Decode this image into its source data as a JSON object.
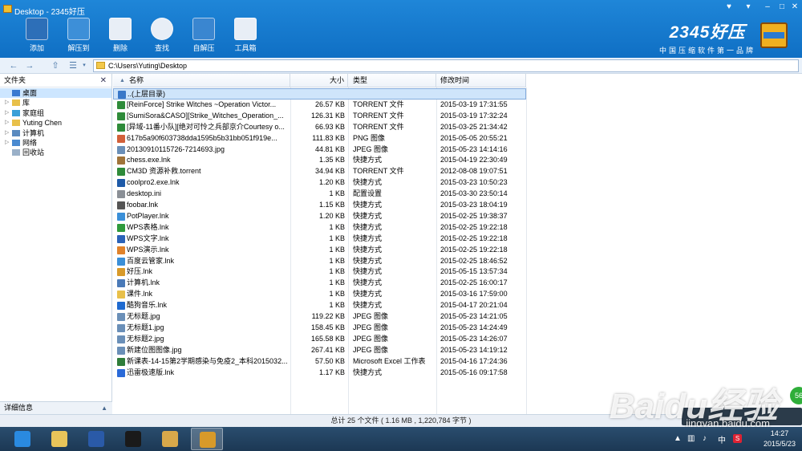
{
  "window": {
    "title": "Desktop - 2345好压"
  },
  "toolbar": {
    "buttons": [
      {
        "label": "添加",
        "icon": "add-archive-icon",
        "color": "#2d6fb8"
      },
      {
        "label": "解压到",
        "icon": "extract-icon",
        "color": "#3d8fd8"
      },
      {
        "label": "删除",
        "icon": "delete-icon",
        "color": "#e8eef6"
      },
      {
        "label": "查找",
        "icon": "search-icon",
        "color": "#e8eef6"
      },
      {
        "label": "自解压",
        "icon": "self-extract-icon",
        "color": "#3a86d0"
      },
      {
        "label": "工具箱",
        "icon": "toolbox-icon",
        "color": "#e8eef6"
      }
    ]
  },
  "brand": {
    "name": "2345好压",
    "tagline": "中国压缩软件第一品牌"
  },
  "address": {
    "path": "C:\\Users\\Yuting\\Desktop"
  },
  "sidebar": {
    "header": "文件夹",
    "footer": "详细信息",
    "items": [
      {
        "label": "桌面",
        "icon": "desktop-icon",
        "selected": true
      },
      {
        "label": "库",
        "icon": "library-icon"
      },
      {
        "label": "家庭组",
        "icon": "homegroup-icon"
      },
      {
        "label": "Yuting Chen",
        "icon": "user-folder-icon"
      },
      {
        "label": "计算机",
        "icon": "computer-icon"
      },
      {
        "label": "网络",
        "icon": "network-icon"
      },
      {
        "label": "回收站",
        "icon": "recycle-bin-icon"
      }
    ]
  },
  "columns": {
    "name": "名称",
    "size": "大小",
    "type": "类型",
    "date": "修改时间"
  },
  "files": [
    {
      "name": "..(上层目录)",
      "size": "",
      "type": "",
      "date": "",
      "icon": "parent-folder-icon",
      "color": "#3a78c8",
      "selected": true
    },
    {
      "name": "[ReinForce] Strike Witches ~Operation Victor...",
      "size": "26.57 KB",
      "type": "TORRENT 文件",
      "date": "2015-03-19 17:31:55",
      "icon": "torrent-icon",
      "color": "#2e8b3a"
    },
    {
      "name": "[SumiSora&CASO][Strike_Witches_Operation_...",
      "size": "126.31 KB",
      "type": "TORRENT 文件",
      "date": "2015-03-19 17:32:24",
      "icon": "torrent-icon",
      "color": "#2e8b3a"
    },
    {
      "name": "[异域-11番小队][绝对可怜之兵部京介Courtesy o...",
      "size": "66.93 KB",
      "type": "TORRENT 文件",
      "date": "2015-03-25 21:34:42",
      "icon": "torrent-icon",
      "color": "#2e8b3a"
    },
    {
      "name": "617b5a90f603738dda1595b5b31bb051f919e...",
      "size": "111.83 KB",
      "type": "PNG 图像",
      "date": "2015-05-05 20:55:21",
      "icon": "png-image-icon",
      "color": "#d2603a"
    },
    {
      "name": "20130910115726-7214693.jpg",
      "size": "44.81 KB",
      "type": "JPEG 图像",
      "date": "2015-05-23 14:14:16",
      "icon": "jpeg-image-icon",
      "color": "#6a8fb8"
    },
    {
      "name": "chess.exe.lnk",
      "size": "1.35 KB",
      "type": "快捷方式",
      "date": "2015-04-19 22:30:49",
      "icon": "chess-icon",
      "color": "#a0743a"
    },
    {
      "name": "CM3D 资源补救.torrent",
      "size": "34.94 KB",
      "type": "TORRENT 文件",
      "date": "2012-08-08 19:07:51",
      "icon": "torrent-icon",
      "color": "#2e8b3a"
    },
    {
      "name": "coolpro2.exe.lnk",
      "size": "1.20 KB",
      "type": "快捷方式",
      "date": "2015-03-23 10:50:23",
      "icon": "coolpro-icon",
      "color": "#1e5aa8"
    },
    {
      "name": "desktop.ini",
      "size": "1 KB",
      "type": "配置设置",
      "date": "2015-03-30 23:50:14",
      "icon": "ini-file-icon",
      "color": "#8a8f96"
    },
    {
      "name": "foobar.lnk",
      "size": "1.15 KB",
      "type": "快捷方式",
      "date": "2015-03-23 18:04:19",
      "icon": "foobar-icon",
      "color": "#555555"
    },
    {
      "name": "PotPlayer.lnk",
      "size": "1.20 KB",
      "type": "快捷方式",
      "date": "2015-02-25 19:38:37",
      "icon": "potplayer-icon",
      "color": "#3a8fd8"
    },
    {
      "name": "WPS表格.lnk",
      "size": "1 KB",
      "type": "快捷方式",
      "date": "2015-02-25 19:22:18",
      "icon": "wps-sheet-icon",
      "color": "#2e9a3c"
    },
    {
      "name": "WPS文字.lnk",
      "size": "1 KB",
      "type": "快捷方式",
      "date": "2015-02-25 19:22:18",
      "icon": "wps-writer-icon",
      "color": "#2a62b8"
    },
    {
      "name": "WPS演示.lnk",
      "size": "1 KB",
      "type": "快捷方式",
      "date": "2015-02-25 19:22:18",
      "icon": "wps-presentation-icon",
      "color": "#e0822a"
    },
    {
      "name": "百度云管家.lnk",
      "size": "1 KB",
      "type": "快捷方式",
      "date": "2015-02-25 18:46:52",
      "icon": "baidu-cloud-icon",
      "color": "#3a8fd8"
    },
    {
      "name": "好压.lnk",
      "size": "1 KB",
      "type": "快捷方式",
      "date": "2015-05-15 13:57:34",
      "icon": "haozip-icon",
      "color": "#d89a2a"
    },
    {
      "name": "计算机.lnk",
      "size": "1 KB",
      "type": "快捷方式",
      "date": "2015-02-25 16:00:17",
      "icon": "computer-icon",
      "color": "#4a7ab8"
    },
    {
      "name": "课件.lnk",
      "size": "1 KB",
      "type": "快捷方式",
      "date": "2015-03-16 17:59:00",
      "icon": "folder-shortcut-icon",
      "color": "#e8c04a"
    },
    {
      "name": "酷狗音乐.lnk",
      "size": "1 KB",
      "type": "快捷方式",
      "date": "2015-04-17 20:21:04",
      "icon": "kugou-icon",
      "color": "#1e6ad0"
    },
    {
      "name": "无标题.jpg",
      "size": "119.22 KB",
      "type": "JPEG 图像",
      "date": "2015-05-23 14:21:05",
      "icon": "jpeg-image-icon",
      "color": "#6a8fb8"
    },
    {
      "name": "无标题1.jpg",
      "size": "158.45 KB",
      "type": "JPEG 图像",
      "date": "2015-05-23 14:24:49",
      "icon": "jpeg-image-icon",
      "color": "#6a8fb8"
    },
    {
      "name": "无标题2.jpg",
      "size": "165.58 KB",
      "type": "JPEG 图像",
      "date": "2015-05-23 14:26:07",
      "icon": "jpeg-image-icon",
      "color": "#6a8fb8"
    },
    {
      "name": "新建位图图像.jpg",
      "size": "267.41 KB",
      "type": "JPEG 图像",
      "date": "2015-05-23 14:19:12",
      "icon": "jpeg-image-icon",
      "color": "#6a8fb8"
    },
    {
      "name": "新课表-14-15第2学期感染与免疫2_本科2015032...",
      "size": "57.50 KB",
      "type": "Microsoft Excel 工作表",
      "date": "2015-04-16 17:24:36",
      "icon": "excel-icon",
      "color": "#2e7d3a"
    },
    {
      "name": "迅雷极速版.lnk",
      "size": "1.17 KB",
      "type": "快捷方式",
      "date": "2015-05-16 09:17:58",
      "icon": "thunder-icon",
      "color": "#2a6ad8"
    }
  ],
  "status": {
    "text": "总计 25 个文件 ( 1.16 MB , 1,220,784 字节 )"
  },
  "taskbar": {
    "apps": [
      {
        "name": "internet-explorer-icon",
        "color": "#2a8ae0",
        "active": false
      },
      {
        "name": "file-explorer-icon",
        "color": "#e8c45a",
        "active": false
      },
      {
        "name": "app-s-icon",
        "color": "#2a5aa8",
        "active": false
      },
      {
        "name": "qq-icon",
        "color": "#1a1a1a",
        "active": false
      },
      {
        "name": "paint-icon",
        "color": "#d8a84a",
        "active": false
      },
      {
        "name": "haozip-icon",
        "color": "#d89a2a",
        "active": true
      }
    ],
    "ime": "中",
    "clock_time": "14:27",
    "clock_date": "2015/5/23"
  },
  "watermark": {
    "logo": "Baidu经验",
    "url": "jingyan.baidu.com"
  },
  "badge": "56"
}
